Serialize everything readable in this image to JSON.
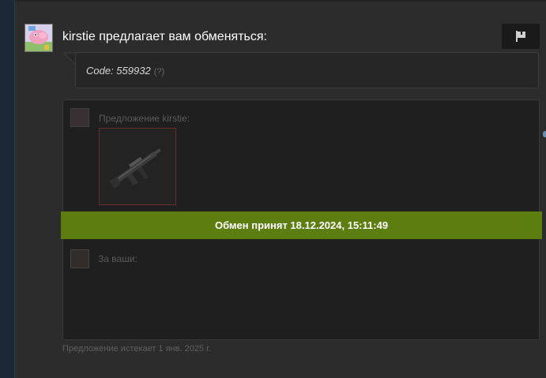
{
  "header": {
    "title": "kirstie предлагает вам обменяться:"
  },
  "icons": {
    "flag": "flag-icon",
    "avatar_main": "pig-avatar",
    "weapon": "rifle-icon"
  },
  "message": {
    "code_text": "Code: 559932",
    "help_text": "(?)"
  },
  "trade": {
    "offer_label": "Предложение kirstie:",
    "accepted_text": "Обмен принят 18.12.2024, 15:11:49",
    "for_yours_label": "За ваши:",
    "expires_text": "Предложение истекает 1 янв. 2025 г."
  },
  "colors": {
    "accepted_bar": "#5c7e10",
    "item_border": "#6e2e27"
  }
}
